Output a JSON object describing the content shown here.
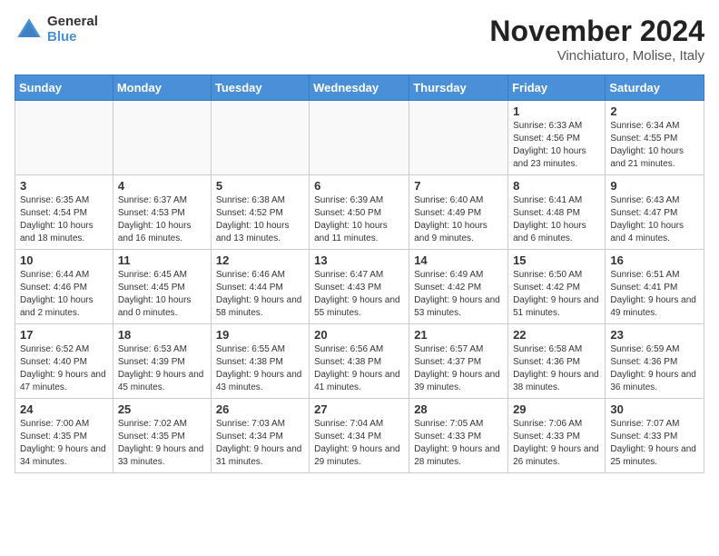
{
  "header": {
    "logo_general": "General",
    "logo_blue": "Blue",
    "month_title": "November 2024",
    "location": "Vinchiaturo, Molise, Italy"
  },
  "weekdays": [
    "Sunday",
    "Monday",
    "Tuesday",
    "Wednesday",
    "Thursday",
    "Friday",
    "Saturday"
  ],
  "weeks": [
    {
      "row_class": "row-even",
      "days": [
        {
          "num": "",
          "info": "",
          "empty": true
        },
        {
          "num": "",
          "info": "",
          "empty": true
        },
        {
          "num": "",
          "info": "",
          "empty": true
        },
        {
          "num": "",
          "info": "",
          "empty": true
        },
        {
          "num": "",
          "info": "",
          "empty": true
        },
        {
          "num": "1",
          "info": "Sunrise: 6:33 AM\nSunset: 4:56 PM\nDaylight: 10 hours and 23 minutes.",
          "empty": false
        },
        {
          "num": "2",
          "info": "Sunrise: 6:34 AM\nSunset: 4:55 PM\nDaylight: 10 hours and 21 minutes.",
          "empty": false
        }
      ]
    },
    {
      "row_class": "row-odd",
      "days": [
        {
          "num": "3",
          "info": "Sunrise: 6:35 AM\nSunset: 4:54 PM\nDaylight: 10 hours and 18 minutes.",
          "empty": false
        },
        {
          "num": "4",
          "info": "Sunrise: 6:37 AM\nSunset: 4:53 PM\nDaylight: 10 hours and 16 minutes.",
          "empty": false
        },
        {
          "num": "5",
          "info": "Sunrise: 6:38 AM\nSunset: 4:52 PM\nDaylight: 10 hours and 13 minutes.",
          "empty": false
        },
        {
          "num": "6",
          "info": "Sunrise: 6:39 AM\nSunset: 4:50 PM\nDaylight: 10 hours and 11 minutes.",
          "empty": false
        },
        {
          "num": "7",
          "info": "Sunrise: 6:40 AM\nSunset: 4:49 PM\nDaylight: 10 hours and 9 minutes.",
          "empty": false
        },
        {
          "num": "8",
          "info": "Sunrise: 6:41 AM\nSunset: 4:48 PM\nDaylight: 10 hours and 6 minutes.",
          "empty": false
        },
        {
          "num": "9",
          "info": "Sunrise: 6:43 AM\nSunset: 4:47 PM\nDaylight: 10 hours and 4 minutes.",
          "empty": false
        }
      ]
    },
    {
      "row_class": "row-even",
      "days": [
        {
          "num": "10",
          "info": "Sunrise: 6:44 AM\nSunset: 4:46 PM\nDaylight: 10 hours and 2 minutes.",
          "empty": false
        },
        {
          "num": "11",
          "info": "Sunrise: 6:45 AM\nSunset: 4:45 PM\nDaylight: 10 hours and 0 minutes.",
          "empty": false
        },
        {
          "num": "12",
          "info": "Sunrise: 6:46 AM\nSunset: 4:44 PM\nDaylight: 9 hours and 58 minutes.",
          "empty": false
        },
        {
          "num": "13",
          "info": "Sunrise: 6:47 AM\nSunset: 4:43 PM\nDaylight: 9 hours and 55 minutes.",
          "empty": false
        },
        {
          "num": "14",
          "info": "Sunrise: 6:49 AM\nSunset: 4:42 PM\nDaylight: 9 hours and 53 minutes.",
          "empty": false
        },
        {
          "num": "15",
          "info": "Sunrise: 6:50 AM\nSunset: 4:42 PM\nDaylight: 9 hours and 51 minutes.",
          "empty": false
        },
        {
          "num": "16",
          "info": "Sunrise: 6:51 AM\nSunset: 4:41 PM\nDaylight: 9 hours and 49 minutes.",
          "empty": false
        }
      ]
    },
    {
      "row_class": "row-odd",
      "days": [
        {
          "num": "17",
          "info": "Sunrise: 6:52 AM\nSunset: 4:40 PM\nDaylight: 9 hours and 47 minutes.",
          "empty": false
        },
        {
          "num": "18",
          "info": "Sunrise: 6:53 AM\nSunset: 4:39 PM\nDaylight: 9 hours and 45 minutes.",
          "empty": false
        },
        {
          "num": "19",
          "info": "Sunrise: 6:55 AM\nSunset: 4:38 PM\nDaylight: 9 hours and 43 minutes.",
          "empty": false
        },
        {
          "num": "20",
          "info": "Sunrise: 6:56 AM\nSunset: 4:38 PM\nDaylight: 9 hours and 41 minutes.",
          "empty": false
        },
        {
          "num": "21",
          "info": "Sunrise: 6:57 AM\nSunset: 4:37 PM\nDaylight: 9 hours and 39 minutes.",
          "empty": false
        },
        {
          "num": "22",
          "info": "Sunrise: 6:58 AM\nSunset: 4:36 PM\nDaylight: 9 hours and 38 minutes.",
          "empty": false
        },
        {
          "num": "23",
          "info": "Sunrise: 6:59 AM\nSunset: 4:36 PM\nDaylight: 9 hours and 36 minutes.",
          "empty": false
        }
      ]
    },
    {
      "row_class": "row-even",
      "days": [
        {
          "num": "24",
          "info": "Sunrise: 7:00 AM\nSunset: 4:35 PM\nDaylight: 9 hours and 34 minutes.",
          "empty": false
        },
        {
          "num": "25",
          "info": "Sunrise: 7:02 AM\nSunset: 4:35 PM\nDaylight: 9 hours and 33 minutes.",
          "empty": false
        },
        {
          "num": "26",
          "info": "Sunrise: 7:03 AM\nSunset: 4:34 PM\nDaylight: 9 hours and 31 minutes.",
          "empty": false
        },
        {
          "num": "27",
          "info": "Sunrise: 7:04 AM\nSunset: 4:34 PM\nDaylight: 9 hours and 29 minutes.",
          "empty": false
        },
        {
          "num": "28",
          "info": "Sunrise: 7:05 AM\nSunset: 4:33 PM\nDaylight: 9 hours and 28 minutes.",
          "empty": false
        },
        {
          "num": "29",
          "info": "Sunrise: 7:06 AM\nSunset: 4:33 PM\nDaylight: 9 hours and 26 minutes.",
          "empty": false
        },
        {
          "num": "30",
          "info": "Sunrise: 7:07 AM\nSunset: 4:33 PM\nDaylight: 9 hours and 25 minutes.",
          "empty": false
        }
      ]
    }
  ]
}
